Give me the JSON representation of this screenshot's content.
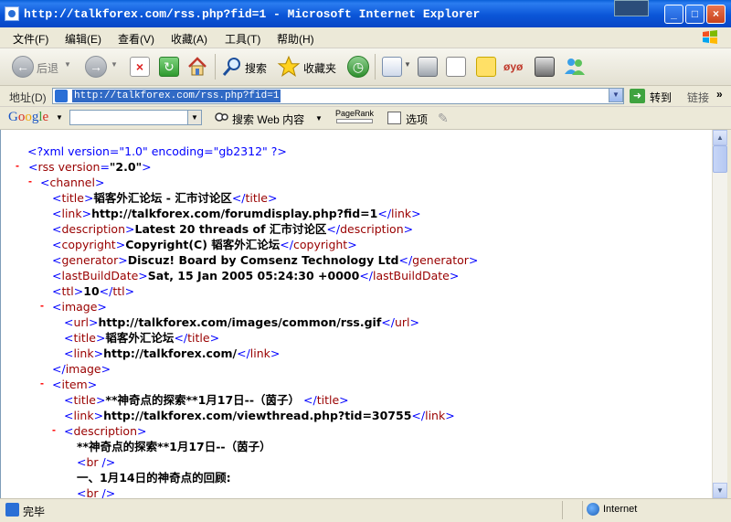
{
  "window": {
    "title": "http://talkforex.com/rss.php?fid=1 - Microsoft Internet Explorer",
    "minimize": "_",
    "maximize": "□",
    "close": "×"
  },
  "menu": [
    "文件(F)",
    "编辑(E)",
    "查看(V)",
    "收藏(A)",
    "工具(T)",
    "帮助(H)"
  ],
  "toolbar": {
    "back_label": "后退",
    "search_label": "搜索",
    "favorites_label": "收藏夹"
  },
  "address": {
    "label": "地址(D)",
    "url": "http://talkforex.com/rss.php?fid=1",
    "go_label": "转到",
    "links_label": "链接"
  },
  "google": {
    "logo": "Google",
    "search_label": "搜索 Web 内容",
    "pagerank_label": "PageRank",
    "options_label": "选项"
  },
  "xml": {
    "pi": "<?xml version=\"1.0\" encoding=\"gb2312\" ?>",
    "rss_attr": "version",
    "rss_attr_value": "\"2.0\"",
    "channel": {
      "title": "韬客外汇论坛 - 汇市讨论区",
      "link": "http://talkforex.com/forumdisplay.php?fid=1",
      "description": "Latest 20 threads of 汇市讨论区",
      "copyright": "Copyright(C) 韬客外汇论坛",
      "generator": "Discuz! Board by Comsenz Technology Ltd",
      "lastBuildDate": "Sat, 15 Jan 2005 05:24:30 +0000",
      "ttl": "10"
    },
    "image": {
      "url": "http://talkforex.com/images/common/rss.gif",
      "title": "韬客外汇论坛",
      "link": "http://talkforex.com/"
    },
    "item": {
      "title": "**神奇点的探索**1月17日--（茵子）",
      "link": "http://talkforex.com/viewthread.php?tid=30755",
      "desc_line1": "**神奇点的探索**1月17日--（茵子）",
      "desc_line2": "一、1月14日的神奇点的回顾:"
    }
  },
  "status": {
    "text": "完毕",
    "zone": "Internet"
  }
}
